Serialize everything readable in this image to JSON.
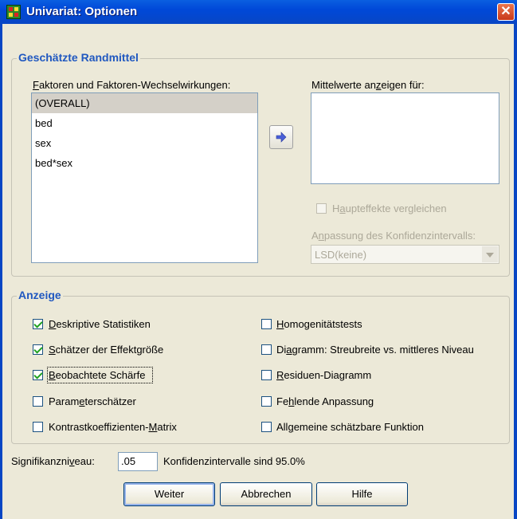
{
  "window": {
    "title": "Univariat: Optionen",
    "close_glyph": "✕"
  },
  "estimated_means": {
    "group_title": "Geschätzte Randmittel",
    "factors_label": "Faktoren und Faktoren-Wechselwirkungen:",
    "factors_label_rest": "aktoren und Faktoren-Wechselwirkungen:",
    "factors_accel": "F",
    "factors": [
      "(OVERALL)",
      "bed",
      "sex",
      "bed*sex"
    ],
    "selected_factor": "(OVERALL)",
    "means_label_pre": "Mittelwerte an",
    "means_label_accel": "z",
    "means_label_post": "eigen für:",
    "move_button_icon": "arrow-right-icon",
    "compare_main_effects_pre": "H",
    "compare_main_effects_accel": "a",
    "compare_main_effects_post": "upteffekte vergleichen",
    "ci_adjust_pre": "A",
    "ci_adjust_accel": "n",
    "ci_adjust_post": "passung des Konfidenzintervalls:",
    "ci_adjust_value": "LSD(keine)"
  },
  "display": {
    "group_title": "Anzeige",
    "left": [
      {
        "pre": "",
        "accel": "D",
        "post": "eskriptive Statistiken",
        "checked": true
      },
      {
        "pre": "",
        "accel": "S",
        "post": "chätzer der Effektgröße",
        "checked": true
      },
      {
        "pre": "",
        "accel": "B",
        "post": "eobachtete Schärfe",
        "checked": true
      },
      {
        "pre": "Param",
        "accel": "e",
        "post": "terschätzer",
        "checked": false
      },
      {
        "pre": "Kontrastkoeffizienten-",
        "accel": "M",
        "post": "atrix",
        "checked": false
      }
    ],
    "right": [
      {
        "pre": "",
        "accel": "H",
        "post": "omogenitätstests",
        "checked": false
      },
      {
        "pre": "Di",
        "accel": "a",
        "post": "gramm: Streubreite vs. mittleres Niveau",
        "checked": false
      },
      {
        "pre": "",
        "accel": "R",
        "post": "esiduen-Diagramm",
        "checked": false
      },
      {
        "pre": "Fe",
        "accel": "h",
        "post": "lende Anpassung",
        "checked": false
      },
      {
        "pre": "All",
        "accel": "g",
        "post": "emeine schätzbare Funktion",
        "checked": false
      }
    ]
  },
  "significance": {
    "label_pre": "Signifikanzni",
    "label_accel": "v",
    "label_post": "eau:",
    "value": ".05",
    "ci_text": "Konfidenzintervalle sind 95.0%"
  },
  "buttons": {
    "continue": "Weiter",
    "cancel": "Abbrechen",
    "help": "Hilfe"
  }
}
